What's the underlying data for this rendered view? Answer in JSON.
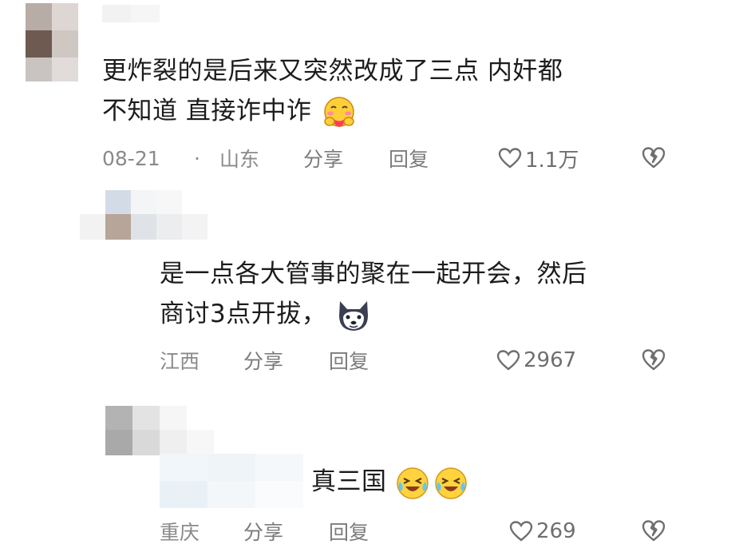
{
  "comments": [
    {
      "lines": [
        "更炸裂的是后来又突然改成了三点  内奸都",
        "不知道  直接诈中诈"
      ],
      "date": "08-21",
      "separator": "·",
      "location": "山东",
      "share_label": "分享",
      "reply_label": "回复",
      "likes": "1.1万"
    },
    {
      "lines": [
        "是一点各大管事的聚在一起开会，然后",
        "商讨3点开拔，"
      ],
      "location": "江西",
      "share_label": "分享",
      "reply_label": "回复",
      "likes": "2967"
    },
    {
      "lines": [
        "真三国"
      ],
      "location": "重庆",
      "share_label": "分享",
      "reply_label": "回复",
      "likes": "269"
    }
  ],
  "icons": {
    "like": "heart-outline-icon",
    "dislike": "broken-heart-icon",
    "emoji_1": "hug-emoji-icon",
    "emoji_2": "wolf-emoji-icon",
    "emoji_3": "crying-laughing-emoji-icon"
  }
}
